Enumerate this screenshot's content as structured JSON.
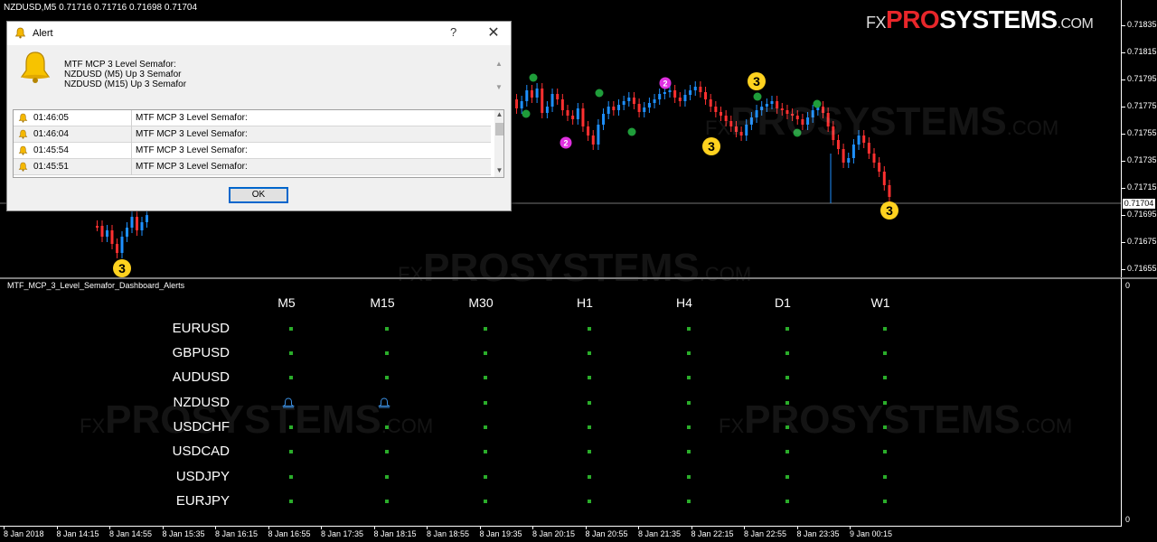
{
  "chart": {
    "title": "NZDUSD,M5  0.71716 0.71716 0.71698 0.71704",
    "current_price": "0.71704",
    "price_labels": [
      "0.71835",
      "0.71815",
      "0.71795",
      "0.71775",
      "0.71755",
      "0.71735",
      "0.71715",
      "0.71695",
      "0.71675",
      "0.71655"
    ],
    "semafor_labels": {
      "big": "3",
      "small": "2"
    }
  },
  "logo": {
    "fx": "FX",
    "pro": "PRO",
    "systems": "SYSTEMS",
    "com": ".COM"
  },
  "watermark": {
    "fx": "FX",
    "pro": "PRO",
    "systems": "SYSTEMS",
    "com": ".COM"
  },
  "indicator": {
    "title": "MTF_MCP_3_Level_Semafor_Dashboard_Alerts",
    "axis_top": "0",
    "axis_bottom": "0",
    "timeframes": [
      "M5",
      "M15",
      "M30",
      "H1",
      "H4",
      "D1",
      "W1"
    ],
    "symbols": [
      "EURUSD",
      "GBPUSD",
      "AUDUSD",
      "NZDUSD",
      "USDCHF",
      "USDCAD",
      "USDJPY",
      "EURJPY"
    ],
    "alert_cells": [
      {
        "symbol": "NZDUSD",
        "timeframe": "M5"
      },
      {
        "symbol": "NZDUSD",
        "timeframe": "M15"
      }
    ],
    "colors": {
      "neutral": "#2aad2a",
      "alert_icon": "#3a8dde"
    }
  },
  "time_axis": [
    "8 Jan 2018",
    "8 Jan 14:15",
    "8 Jan 14:55",
    "8 Jan 15:35",
    "8 Jan 16:15",
    "8 Jan 16:55",
    "8 Jan 17:35",
    "8 Jan 18:15",
    "8 Jan 18:55",
    "8 Jan 19:35",
    "8 Jan 20:15",
    "8 Jan 20:55",
    "8 Jan 21:35",
    "8 Jan 22:15",
    "8 Jan 22:55",
    "8 Jan 23:35",
    "9 Jan 00:15"
  ],
  "alert": {
    "title": "Alert",
    "help": "?",
    "close": "✕",
    "message": [
      "MTF MCP 3 Level Semafor:",
      "NZDUSD (M5) Up 3 Semafor",
      "NZDUSD (M15) Up 3 Semafor"
    ],
    "list": [
      {
        "time": "01:46:05",
        "message": "MTF MCP 3 Level Semafor:"
      },
      {
        "time": "01:46:04",
        "message": "MTF MCP 3 Level Semafor:"
      },
      {
        "time": "01:45:54",
        "message": "MTF MCP 3 Level Semafor:"
      },
      {
        "time": "01:45:51",
        "message": "MTF MCP 3 Level Semafor:"
      }
    ],
    "ok_label": "OK"
  },
  "colors": {
    "bull": "#1e90ff",
    "bear": "#ff3030",
    "semafor3": "#ffd21f",
    "semafor2": "#e030e0",
    "semafor1": "#1f9d3a",
    "logo_red": "#e8262a"
  }
}
